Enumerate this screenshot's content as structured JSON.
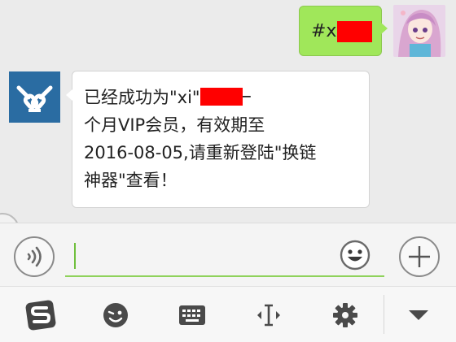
{
  "chat": {
    "outgoing": {
      "text": "#xi",
      "avatar": "anime-avatar"
    },
    "incoming": {
      "text": "已经成功为\"xi\"开通一\n个月VIP会员，有效期至\n2016-08-05,请重新登陆\"换链\n神器\"查看！",
      "avatar": "chain-link-logo"
    }
  },
  "colors": {
    "outgoing_bubble": "#a0e75a",
    "redaction": "#ff0000",
    "input_underline": "#8fd25b",
    "bot_avatar_bg": "#2a6ca2"
  },
  "input_bar": {
    "voice_icon": "voice-icon",
    "input_value": "",
    "emoji_icon": "emoji-icon",
    "plus_icon": "plus-icon"
  },
  "keyboard_toolbar": {
    "items": [
      "sogou-logo-icon",
      "emoji-face-icon",
      "keyboard-icon",
      "cursor-icon",
      "settings-gear-icon",
      "collapse-arrow-icon"
    ]
  }
}
